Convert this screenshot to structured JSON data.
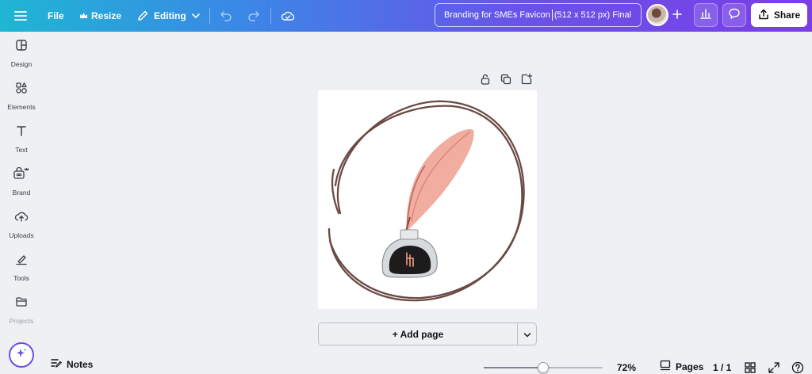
{
  "topbar": {
    "file_label": "File",
    "resize_label": "Resize",
    "editing_label": "Editing",
    "doc_title_part1": "Branding for SMEs Favicon",
    "doc_title_part2": "(512 x 512 px) Final",
    "share_label": "Share",
    "icons": [
      "menu-icon",
      "crown-icon",
      "pencil-icon",
      "chevron-down-icon",
      "undo-icon",
      "redo-icon",
      "cloud-check-icon",
      "plus-icon",
      "chart-icon",
      "comment-icon",
      "share-upload-icon"
    ]
  },
  "sidebar": {
    "items": [
      {
        "label": "Design",
        "icon": "design-icon"
      },
      {
        "label": "Elements",
        "icon": "elements-icon"
      },
      {
        "label": "Text",
        "icon": "text-icon"
      },
      {
        "label": "Brand",
        "icon": "brand-icon"
      },
      {
        "label": "Uploads",
        "icon": "uploads-icon"
      },
      {
        "label": "Tools",
        "icon": "tools-icon"
      },
      {
        "label": "Projects",
        "icon": "projects-icon"
      }
    ]
  },
  "canvas": {
    "add_page_label": "+ Add page",
    "page_tools": [
      "lock-icon",
      "duplicate-icon",
      "add-to-page-icon"
    ]
  },
  "bottombar": {
    "notes_label": "Notes",
    "zoom_value": "72%",
    "zoom_fraction": 0.5,
    "pages_label": "Pages",
    "page_count": "1 / 1"
  },
  "colors": {
    "accent_start": "#1fb6d3",
    "accent_end": "#7a3ee6",
    "ring": "#6b4a44",
    "feather": "#f0a99a"
  }
}
